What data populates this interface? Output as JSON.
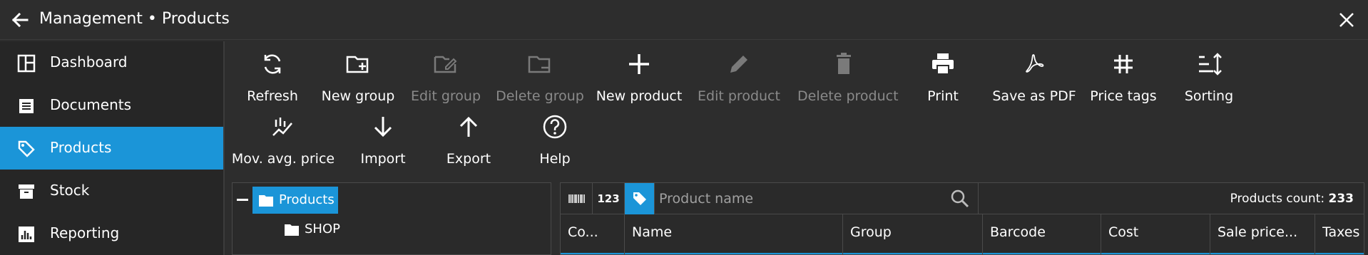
{
  "window": {
    "title": "Management • Products"
  },
  "sidebar": {
    "items": [
      {
        "label": "Dashboard",
        "icon": "dashboard-icon",
        "active": false
      },
      {
        "label": "Documents",
        "icon": "documents-icon",
        "active": false
      },
      {
        "label": "Products",
        "icon": "tag-icon",
        "active": true
      },
      {
        "label": "Stock",
        "icon": "stock-icon",
        "active": false
      },
      {
        "label": "Reporting",
        "icon": "reporting-icon",
        "active": false
      }
    ]
  },
  "toolbar": {
    "refresh": "Refresh",
    "new_group": "New group",
    "edit_group": "Edit group",
    "delete_group": "Delete group",
    "new_product": "New product",
    "edit_product": "Edit product",
    "delete_product": "Delete product",
    "print": "Print",
    "save_pdf": "Save as PDF",
    "price_tags": "Price tags",
    "sorting": "Sorting",
    "mov_avg_price": "Mov. avg. price",
    "import": "Import",
    "export": "Export",
    "help": "Help"
  },
  "tree": {
    "root": "Products",
    "children": [
      "SHOP"
    ]
  },
  "search": {
    "code_label": "123",
    "placeholder": "Product name",
    "count_label": "Products count:",
    "count_value": "233"
  },
  "table": {
    "columns": [
      "Co...",
      "Name",
      "Group",
      "Barcode",
      "Cost",
      "Sale price...",
      "Taxes"
    ]
  },
  "colors": {
    "accent": "#1b95d8",
    "background": "#2d2d2d",
    "sidebar": "#262626",
    "disabled_text": "#8a8a8a"
  }
}
